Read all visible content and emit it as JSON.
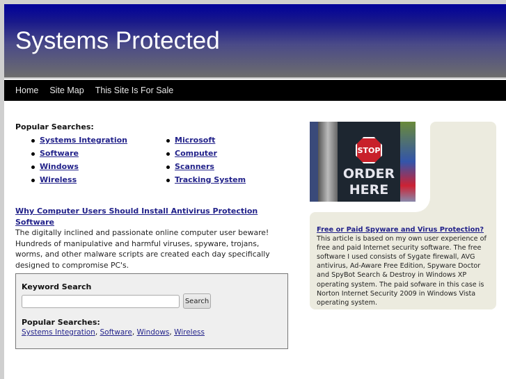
{
  "site": {
    "title": "Systems Protected"
  },
  "nav": [
    "Home",
    "Site Map",
    "This Site Is For Sale"
  ],
  "popular": {
    "label": "Popular Searches:",
    "col1": [
      "Systems Integration",
      "Software",
      "Windows",
      "Wireless"
    ],
    "col2": [
      "Microsoft",
      "Computer",
      "Scanners",
      "Tracking System"
    ]
  },
  "article": {
    "title": "Why Computer Users Should Install Antivirus Protection Software",
    "body": "The digitally inclined and passionate online computer user beware! Hundreds of manipulative and harmful viruses, spyware, trojans, worms, and other malware scripts are created each day specifically designed to compromise PC's."
  },
  "search": {
    "label": "Keyword Search",
    "value": "",
    "button": "Search",
    "popular_label": "Popular Searches:",
    "links": [
      "Systems Integration",
      "Software",
      "Windows",
      "Wireless"
    ]
  },
  "promo": {
    "stop": "STOP",
    "line1": "ORDER",
    "line2": "HERE"
  },
  "sidebar": {
    "title": "Free or Paid Spyware and Virus Protection?",
    "body": "This article is based on my own user experience of free and paid Internet security software. The free software I used consists of Sygate firewall, AVG antivirus, Ad-Aware Free Edition, Spyware Doctor and SpyBot Search & Destroy in Windows XP operating system. The paid sofware in this case is Norton Internet Security 2009 in Windows Vista operating system."
  }
}
